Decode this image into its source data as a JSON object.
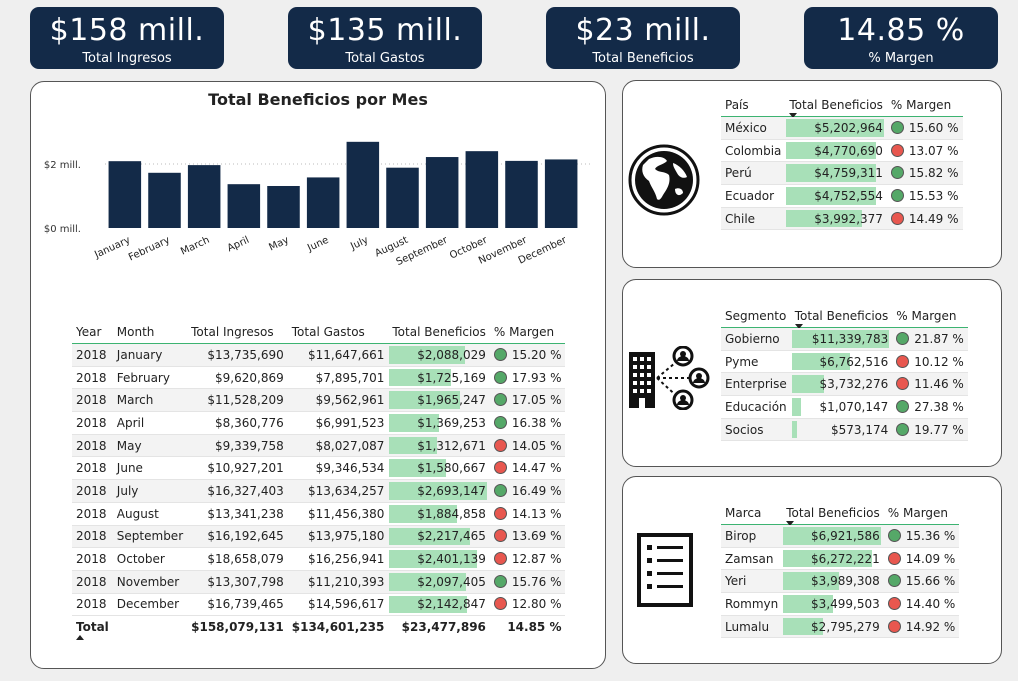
{
  "kpis": [
    {
      "value": "$158 mill.",
      "label": "Total Ingresos"
    },
    {
      "value": "$135 mill.",
      "label": "Total Gastos"
    },
    {
      "value": "$23 mill.",
      "label": "Total Beneficios"
    },
    {
      "value": "14.85 %",
      "label": "% Margen"
    }
  ],
  "chart": {
    "title": "Total Beneficios por Mes",
    "ytick_top": "$2 mill.",
    "ytick_bottom": "$0 mill."
  },
  "chart_data": {
    "type": "bar",
    "title": "Total Beneficios por Mes",
    "categories": [
      "January",
      "February",
      "March",
      "April",
      "May",
      "June",
      "July",
      "August",
      "September",
      "October",
      "November",
      "December"
    ],
    "values": [
      2088029,
      1725169,
      1965247,
      1369253,
      1312671,
      1580667,
      2693147,
      1884858,
      2217465,
      2401139,
      2097405,
      2142847
    ],
    "yticks": [
      "$0 mill.",
      "$2 mill."
    ],
    "ylim": [
      0,
      3000000
    ],
    "color": "#132a48",
    "grid": true
  },
  "monthly": {
    "headers": [
      "Year",
      "Month",
      "Total Ingresos",
      "Total Gastos",
      "Total Beneficios",
      "% Margen"
    ],
    "rows": [
      {
        "year": "2018",
        "month": "January",
        "ing": "$13,735,690",
        "gas": "$11,647,661",
        "ben": "$2,088,029",
        "benv": 2088029,
        "mar": "15.20 %",
        "status": "g"
      },
      {
        "year": "2018",
        "month": "February",
        "ing": "$9,620,869",
        "gas": "$7,895,701",
        "ben": "$1,725,169",
        "benv": 1725169,
        "mar": "17.93 %",
        "status": "g"
      },
      {
        "year": "2018",
        "month": "March",
        "ing": "$11,528,209",
        "gas": "$9,562,961",
        "ben": "$1,965,247",
        "benv": 1965247,
        "mar": "17.05 %",
        "status": "g"
      },
      {
        "year": "2018",
        "month": "April",
        "ing": "$8,360,776",
        "gas": "$6,991,523",
        "ben": "$1,369,253",
        "benv": 1369253,
        "mar": "16.38 %",
        "status": "g"
      },
      {
        "year": "2018",
        "month": "May",
        "ing": "$9,339,758",
        "gas": "$8,027,087",
        "ben": "$1,312,671",
        "benv": 1312671,
        "mar": "14.05 %",
        "status": "r"
      },
      {
        "year": "2018",
        "month": "June",
        "ing": "$10,927,201",
        "gas": "$9,346,534",
        "ben": "$1,580,667",
        "benv": 1580667,
        "mar": "14.47 %",
        "status": "r"
      },
      {
        "year": "2018",
        "month": "July",
        "ing": "$16,327,403",
        "gas": "$13,634,257",
        "ben": "$2,693,147",
        "benv": 2693147,
        "mar": "16.49 %",
        "status": "g"
      },
      {
        "year": "2018",
        "month": "August",
        "ing": "$13,341,238",
        "gas": "$11,456,380",
        "ben": "$1,884,858",
        "benv": 1884858,
        "mar": "14.13 %",
        "status": "r"
      },
      {
        "year": "2018",
        "month": "September",
        "ing": "$16,192,645",
        "gas": "$13,975,180",
        "ben": "$2,217,465",
        "benv": 2217465,
        "mar": "13.69 %",
        "status": "r"
      },
      {
        "year": "2018",
        "month": "October",
        "ing": "$18,658,079",
        "gas": "$16,256,941",
        "ben": "$2,401,139",
        "benv": 2401139,
        "mar": "12.87 %",
        "status": "r"
      },
      {
        "year": "2018",
        "month": "November",
        "ing": "$13,307,798",
        "gas": "$11,210,393",
        "ben": "$2,097,405",
        "benv": 2097405,
        "mar": "15.76 %",
        "status": "g"
      },
      {
        "year": "2018",
        "month": "December",
        "ing": "$16,739,465",
        "gas": "$14,596,617",
        "ben": "$2,142,847",
        "benv": 2142847,
        "mar": "12.80 %",
        "status": "r"
      }
    ],
    "total": {
      "label": "Total",
      "ing": "$158,079,131",
      "gas": "$134,601,235",
      "ben": "$23,477,896",
      "mar": "14.85 %"
    }
  },
  "pais": {
    "headers": [
      "País",
      "Total Beneficios",
      "% Margen"
    ],
    "rows": [
      {
        "name": "México",
        "ben": "$5,202,964",
        "benv": 5202964,
        "mar": "15.60 %",
        "status": "g"
      },
      {
        "name": "Colombia",
        "ben": "$4,770,690",
        "benv": 4770690,
        "mar": "13.07 %",
        "status": "r"
      },
      {
        "name": "Perú",
        "ben": "$4,759,311",
        "benv": 4759311,
        "mar": "15.82 %",
        "status": "g"
      },
      {
        "name": "Ecuador",
        "ben": "$4,752,554",
        "benv": 4752554,
        "mar": "15.53 %",
        "status": "g"
      },
      {
        "name": "Chile",
        "ben": "$3,992,377",
        "benv": 3992377,
        "mar": "14.49 %",
        "status": "r"
      }
    ],
    "icon": "globe-icon"
  },
  "segmento": {
    "headers": [
      "Segmento",
      "Total Beneficios",
      "% Margen"
    ],
    "rows": [
      {
        "name": "Gobierno",
        "ben": "$11,339,783",
        "benv": 11339783,
        "mar": "21.87 %",
        "status": "g"
      },
      {
        "name": "Pyme",
        "ben": "$6,762,516",
        "benv": 6762516,
        "mar": "10.12 %",
        "status": "r"
      },
      {
        "name": "Enterprise",
        "ben": "$3,732,276",
        "benv": 3732276,
        "mar": "11.46 %",
        "status": "r"
      },
      {
        "name": "Educación",
        "ben": "$1,070,147",
        "benv": 1070147,
        "mar": "27.38 %",
        "status": "g"
      },
      {
        "name": "Socios",
        "ben": "$573,174",
        "benv": 573174,
        "mar": "19.77 %",
        "status": "g"
      }
    ],
    "icon": "building-network-icon"
  },
  "marca": {
    "headers": [
      "Marca",
      "Total Beneficios",
      "% Margen"
    ],
    "rows": [
      {
        "name": "Birop",
        "ben": "$6,921,586",
        "benv": 6921586,
        "mar": "15.36 %",
        "status": "g"
      },
      {
        "name": "Zamsan",
        "ben": "$6,272,221",
        "benv": 6272221,
        "mar": "14.09 %",
        "status": "r"
      },
      {
        "name": "Yeri",
        "ben": "$3,989,308",
        "benv": 3989308,
        "mar": "15.66 %",
        "status": "g"
      },
      {
        "name": "Rommyn",
        "ben": "$3,499,503",
        "benv": 3499503,
        "mar": "14.40 %",
        "status": "r"
      },
      {
        "name": "Lumalu",
        "ben": "$2,795,279",
        "benv": 2795279,
        "mar": "14.92 %",
        "status": "r"
      }
    ],
    "icon": "list-document-icon"
  },
  "colors": {
    "navy": "#132a48",
    "bar_fill": "#a8e0b8",
    "green": "#55a868",
    "red": "#e8574f",
    "accent_line": "#3cb371"
  }
}
